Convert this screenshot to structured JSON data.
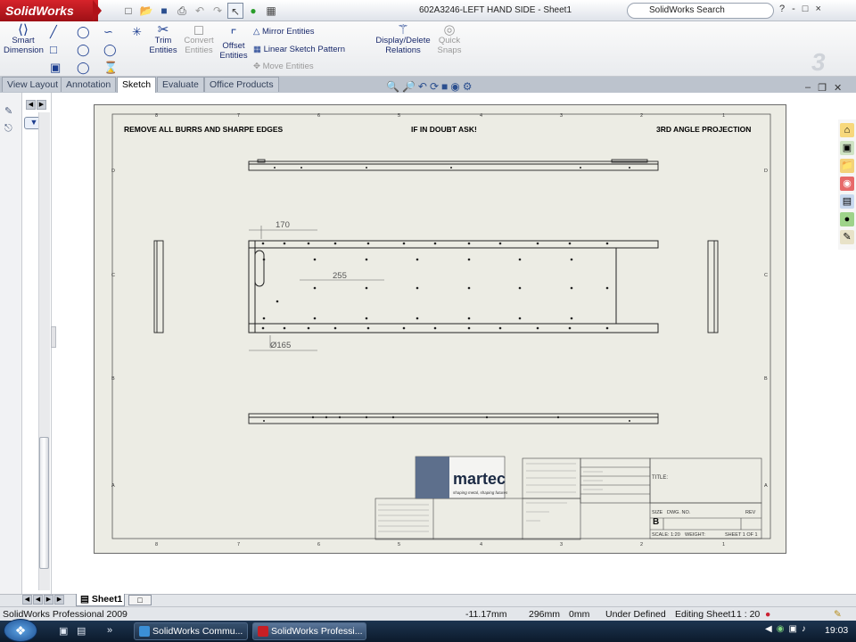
{
  "app": {
    "logo_text": "SolidWorks",
    "doc_title": "602A3246-LEFT HAND SIDE - Sheet1",
    "search_placeholder": "SolidWorks Search",
    "window_controls": [
      "?",
      "-",
      "□",
      "×"
    ]
  },
  "ribbon": {
    "smart_dimension": "Smart Dimension",
    "trim_entities": "Trim Entities",
    "convert_entities": "Convert Entities",
    "offset_entities": "Offset Entities",
    "mirror_entities": "Mirror Entities",
    "linear_sketch_pattern": "Linear Sketch Pattern",
    "move_entities": "Move Entities",
    "display_delete_relations": "Display/Delete Relations",
    "quick_snaps": "Quick Snaps"
  },
  "tabs": [
    {
      "label": "View Layout"
    },
    {
      "label": "Annotation"
    },
    {
      "label": "Sketch"
    },
    {
      "label": "Evaluate"
    },
    {
      "label": "Office Products"
    }
  ],
  "drawing": {
    "note_left": "REMOVE ALL BURRS AND SHARPE EDGES",
    "note_center": "IF IN DOUBT ASK!",
    "note_right": "3RD ANGLE PROJECTION",
    "dim_170": "170",
    "dim_255": "255",
    "dim_165": "Ø165",
    "col_labels_top": [
      "8",
      "7",
      "6",
      "5",
      "4",
      "3",
      "2",
      "1"
    ],
    "col_labels_bottom": [
      "8",
      "7",
      "6",
      "5",
      "4",
      "3",
      "2",
      "1"
    ],
    "row_labels_left": [
      "D",
      "C",
      "B",
      "A"
    ],
    "row_labels_right": [
      "D",
      "C",
      "B",
      "A"
    ],
    "title_block": {
      "company": "martec",
      "tagline": "shaping metal, shaping futures",
      "title_label": "TITLE:",
      "size_label": "SIZE",
      "size_value": "B",
      "dwg_no_label": "DWG. NO.",
      "rev_label": "REV",
      "scale_label": "SCALE: 1:20",
      "weight_label": "WEIGHT:",
      "sheet_label": "SHEET 1 OF 1"
    }
  },
  "sheet_tab": "Sheet1",
  "status": {
    "app_name": "SolidWorks Professional 2009",
    "x": "-11.17mm",
    "y": "296mm",
    "z": "0mm",
    "state": "Under Defined",
    "editing": "Editing Sheet1",
    "scale": "1 : 20"
  },
  "taskbar": {
    "btn1": "SolidWorks Commu...",
    "btn2": "SolidWorks Professi...",
    "clock": "19:03"
  }
}
